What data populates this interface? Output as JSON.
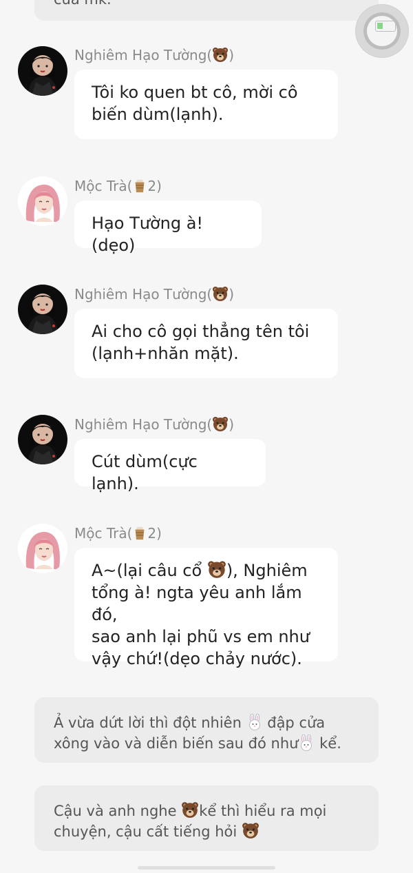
{
  "top_narration": {
    "text": "của mk."
  },
  "messages": [
    {
      "sender_name": "Nghiêm Hạo Tường(",
      "sender_icon": "bear-icon",
      "sender_suffix": ")",
      "text_lines": [
        "Tôi ko quen bt cô, mời cô",
        "biến dùm(lạnh)."
      ]
    },
    {
      "sender_name": "Mộc Trà(",
      "sender_icon": "cup-icon",
      "sender_suffix": "2)",
      "text_lines": [
        "Hạo Tường à!(dẹo)"
      ]
    },
    {
      "sender_name": "Nghiêm Hạo Tường(",
      "sender_icon": "bear-icon",
      "sender_suffix": ")",
      "text_lines": [
        "Ai cho cô gọi thẳng tên tôi",
        "(lạnh+nhăn mặt)."
      ]
    },
    {
      "sender_name": "Nghiêm Hạo Tường(",
      "sender_icon": "bear-icon",
      "sender_suffix": ")",
      "text_lines": [
        "Cút dùm(cực lạnh)."
      ]
    },
    {
      "sender_name": "Mộc Trà(",
      "sender_icon": "cup-icon",
      "sender_suffix": "2)",
      "line1_before": "A~(lại câu cổ ",
      "line1_after": "), Nghiêm",
      "text_lines": [
        "tổng à! ngta yêu anh lắm đó,",
        "sao anh lại phũ vs em như",
        "vậy chứ!(dẹo chảy nước)."
      ]
    }
  ],
  "narrations": [
    {
      "l1_before": "Ả vừa dứt lời thì đột nhiên ",
      "l1_after": " đập cửa",
      "l2_before": "xông vào và diễn biến sau đó như",
      "l2_after": " kể."
    },
    {
      "l1_before": "Cậu và anh nghe ",
      "l1_after": "kể thì hiểu ra mọi",
      "l2_before": "chuyện, cậu cất tiếng hỏi ",
      "l2_after": ""
    }
  ],
  "colors": {
    "background": "#f6f6f6",
    "bubble": "#ffffff",
    "narration": "#ececec",
    "sender_name": "#8a8a8a",
    "battery_fill": "#8bd48b"
  }
}
